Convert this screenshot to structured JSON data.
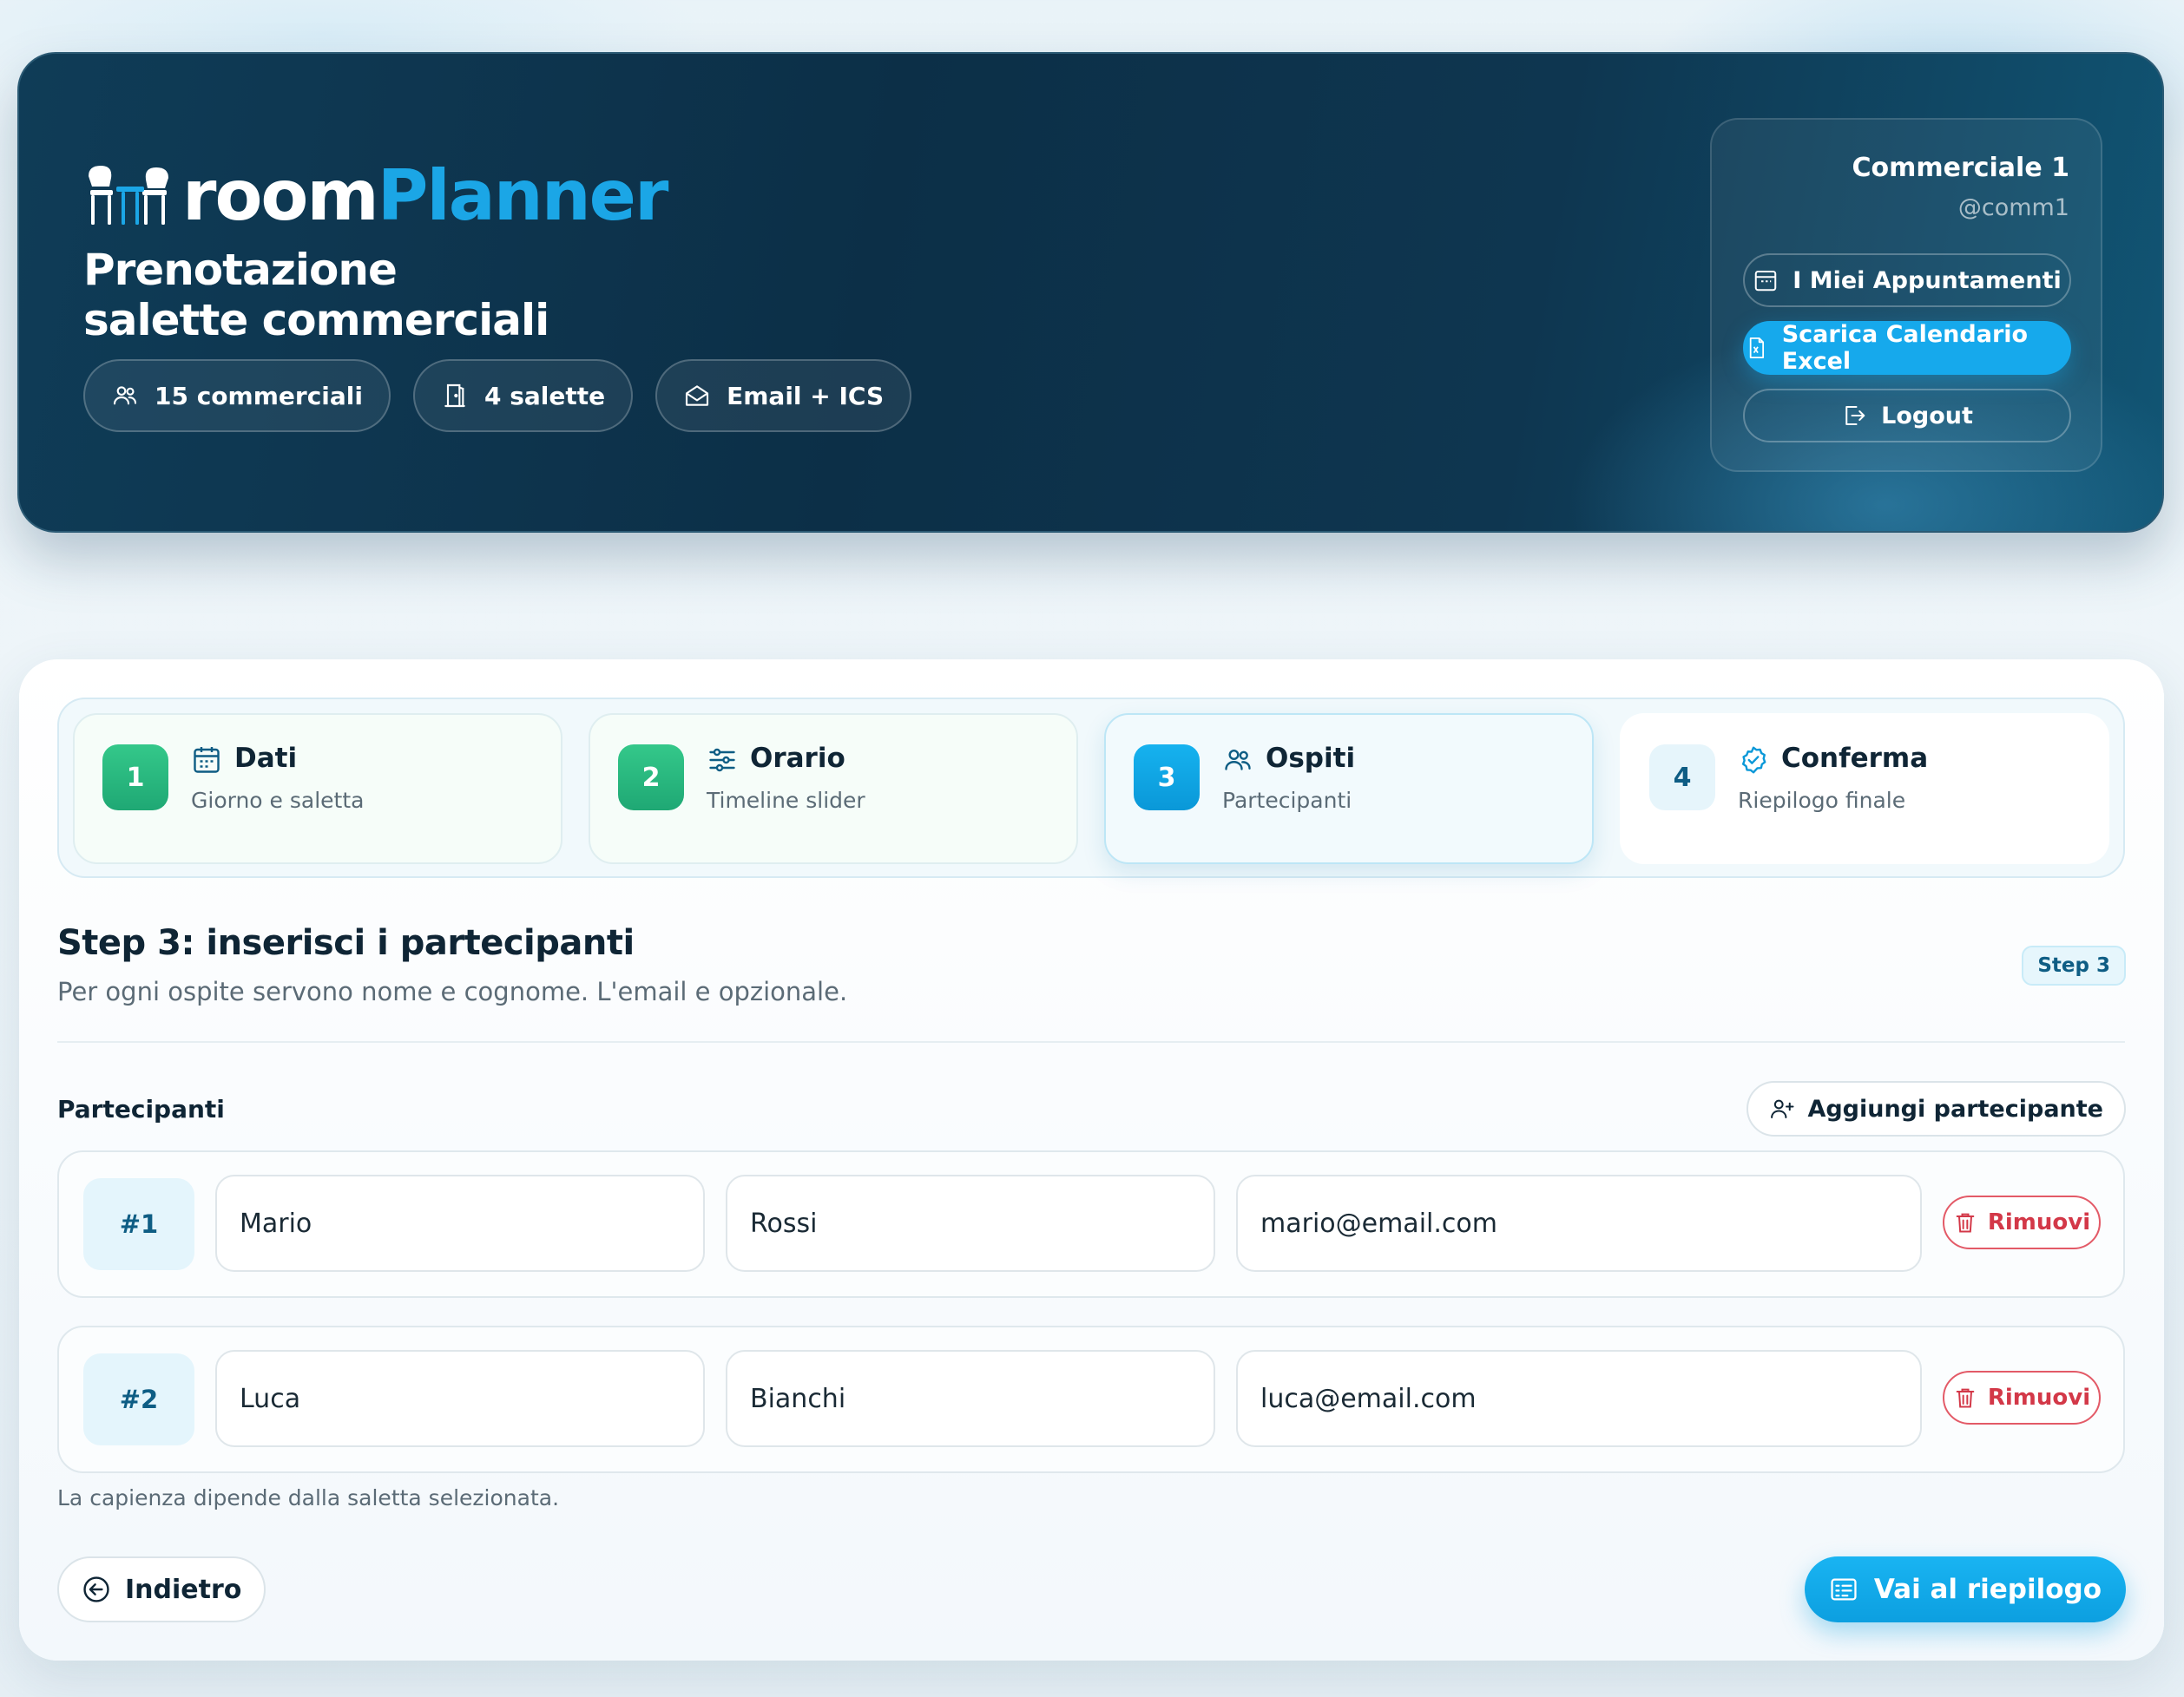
{
  "brand": {
    "room": "room",
    "planner": "Planner"
  },
  "header": {
    "title": "Prenotazione salette commerciali",
    "chips": [
      {
        "label": "15 commerciali",
        "icon": "users-icon"
      },
      {
        "label": "4 salette",
        "icon": "door-icon"
      },
      {
        "label": "Email + ICS",
        "icon": "mail-icon"
      }
    ]
  },
  "user": {
    "name": "Commerciale 1",
    "handle": "@comm1",
    "buttons": {
      "appointments": "I Miei Appuntamenti",
      "download": "Scarica Calendario Excel",
      "logout": "Logout"
    }
  },
  "stepper": {
    "steps": [
      {
        "num": "1",
        "title": "Dati",
        "sub": "Giorno e saletta",
        "state": "done"
      },
      {
        "num": "2",
        "title": "Orario",
        "sub": "Timeline slider",
        "state": "done"
      },
      {
        "num": "3",
        "title": "Ospiti",
        "sub": "Partecipanti",
        "state": "active"
      },
      {
        "num": "4",
        "title": "Conferma",
        "sub": "Riepilogo finale",
        "state": "todo"
      }
    ]
  },
  "section": {
    "title": "Step 3: inserisci i partecipanti",
    "subtitle": "Per ogni ospite servono nome e cognome. L'email e opzionale.",
    "badge": "Step 3"
  },
  "participants": {
    "label": "Partecipanti",
    "add_label": "Aggiungi partecipante",
    "remove_label": "Rimuovi",
    "rows": [
      {
        "num": "#1",
        "first": "Mario",
        "last": "Rossi",
        "email": "mario@email.com"
      },
      {
        "num": "#2",
        "first": "Luca",
        "last": "Bianchi",
        "email": "luca@email.com"
      }
    ],
    "note": "La capienza dipende dalla saletta selezionata."
  },
  "nav": {
    "back": "Indietro",
    "next": "Vai al riepilogo"
  },
  "colors": {
    "accent": "#16a9ec",
    "success": "#22b07b",
    "danger": "#d33848",
    "hero": "#0e3650"
  }
}
